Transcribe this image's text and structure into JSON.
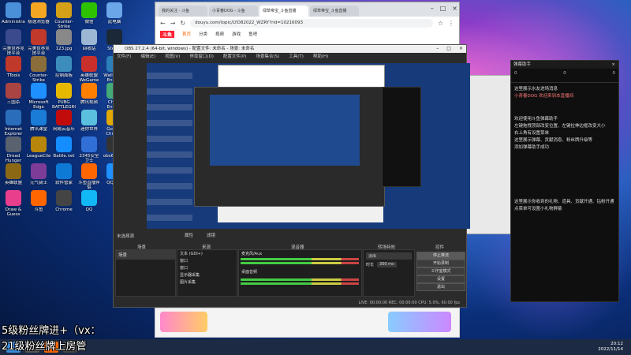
{
  "desktop": {
    "icons": [
      {
        "label": "Administrator",
        "color": "#4a90d9"
      },
      {
        "label": "极速浏览器",
        "color": "#f5a623"
      },
      {
        "label": "Counter-Strike Global Offensive",
        "color": "#d4a017"
      },
      {
        "label": "微信",
        "color": "#2dc100"
      },
      {
        "label": "此电脑",
        "color": "#6aa6e8"
      },
      {
        "label": "完美世界竞技平台",
        "color": "#3b4a8c"
      },
      {
        "label": "完美世界竞技平台",
        "color": "#c0392b"
      },
      {
        "label": "123.jpg",
        "color": "#888"
      },
      {
        "label": "回收站",
        "color": "#9bb7d4"
      },
      {
        "label": "Steam",
        "color": "#1b2838"
      },
      {
        "label": "TTools",
        "color": "#c0392b"
      },
      {
        "label": "Counter-Strike",
        "color": "#8a6d3b"
      },
      {
        "label": "控制面板",
        "color": "#3c8dbc"
      },
      {
        "label": "英雄联盟WeGame",
        "color": "#c9302c"
      },
      {
        "label": "Wallpaper Engine",
        "color": "#2c7fb8"
      },
      {
        "label": "三国杀",
        "color": "#a94442"
      },
      {
        "label": "Microsoft Edge",
        "color": "#1e90ff"
      },
      {
        "label": "PUBG BATTLEGROUNDS",
        "color": "#e6b800"
      },
      {
        "label": "腾讯视频",
        "color": "#ff7f00"
      },
      {
        "label": "Cheat Engine",
        "color": "#4a7"
      },
      {
        "label": "Internet Explorer",
        "color": "#2a6ebb"
      },
      {
        "label": "腾讯课堂",
        "color": "#1a7cd6"
      },
      {
        "label": "网易云音乐",
        "color": "#c20c0c"
      },
      {
        "label": "迷你世界",
        "color": "#5bc0de"
      },
      {
        "label": "Google Chrome",
        "color": "#e0a800"
      },
      {
        "label": "Dread Hunger",
        "color": "#5a6270"
      },
      {
        "label": "LeagueClient",
        "color": "#b8860b"
      },
      {
        "label": "Battle.net",
        "color": "#148eff"
      },
      {
        "label": "2345安全卫士",
        "color": "#2f6fd6"
      },
      {
        "label": "obs64.exe",
        "color": "#333"
      },
      {
        "label": "英雄联盟",
        "color": "#8b6914"
      },
      {
        "label": "元气骑士",
        "color": "#7d3c98"
      },
      {
        "label": "软件管家",
        "color": "#0e7ad6"
      },
      {
        "label": "斗鱼直播伴侣",
        "color": "#ff6600"
      },
      {
        "label": "QQ游戏",
        "color": "#1e90ff"
      },
      {
        "label": "Draw & Guess",
        "color": "#e83e8c"
      },
      {
        "label": "斗鱼",
        "color": "#f60"
      },
      {
        "label": "Chrome",
        "color": "#444"
      },
      {
        "label": "QQ",
        "color": "#12b7f5"
      }
    ]
  },
  "browser": {
    "tabs": [
      "我的关注 - 斗鱼",
      "小青春DOG - 斗鱼",
      "绿草帝宝_斗鱼直播",
      "绿草帝宝_斗鱼直播"
    ],
    "url": "douyu.com/topic/LYD82022_WZRY?rid=10216093",
    "nav": [
      "斗鱼",
      "首页",
      "分类",
      "视频",
      "游戏",
      "鱼吧"
    ]
  },
  "obs": {
    "title": "OBS 27.2.4 (64-bit, windows) - 配置文件: 未命名 - 场景: 未命名",
    "menu": [
      "文件(F)",
      "编辑(E)",
      "视图(V)",
      "停靠窗口(D)",
      "配置文件(P)",
      "场景集合(S)",
      "工具(T)",
      "帮助(H)"
    ],
    "no_source": "未选择源",
    "properties": "属性",
    "filters": "滤镜",
    "docks": {
      "scenes": "场景",
      "sources": "来源",
      "mixer": "混音器",
      "transitions": "转场特效",
      "controls": "控件"
    },
    "scene_item": "场景",
    "sources_list": [
      "文本 (GDI+)",
      "窗口",
      "窗口",
      "显示器采集",
      "图片采集"
    ],
    "mixer_tracks": [
      "麦克风/Aux",
      "桌面音频"
    ],
    "transition": {
      "type": "淡出",
      "duration_label": "时长",
      "duration": "300 ms"
    },
    "controls": [
      "停止推流",
      "开始录制",
      "工作室模式",
      "设置",
      "退出"
    ],
    "status": "LIVE: 00:00:00   REC: 00:00:00   CPU: 5.0%, 60.00 fps"
  },
  "chat": {
    "title": "弹幕助手",
    "stats": [
      "0",
      "0",
      "0"
    ],
    "messages": [
      "这里展示水友进场消息",
      "小青春DOG 欢迎来到本直播间",
      "欢迎使用斗鱼弹幕助手",
      "左键拖拽顶部改变位置、左键拉伸边框改变大小",
      "右上角有设置菜单",
      "这里展示弹幕、贡献消息、粉丝牌升级等",
      "添加弹幕助手成功",
      "这里展示你收到的礼物、道具、贡献开通、钻粉开通",
      "点菜单可设置小礼物屏蔽"
    ]
  },
  "overlay": {
    "line1": "5级粉丝牌进+（vx：",
    "line2": "21级粉丝牌上房管"
  },
  "taskbar": {
    "time": "20:12",
    "date": "2022/11/14"
  }
}
